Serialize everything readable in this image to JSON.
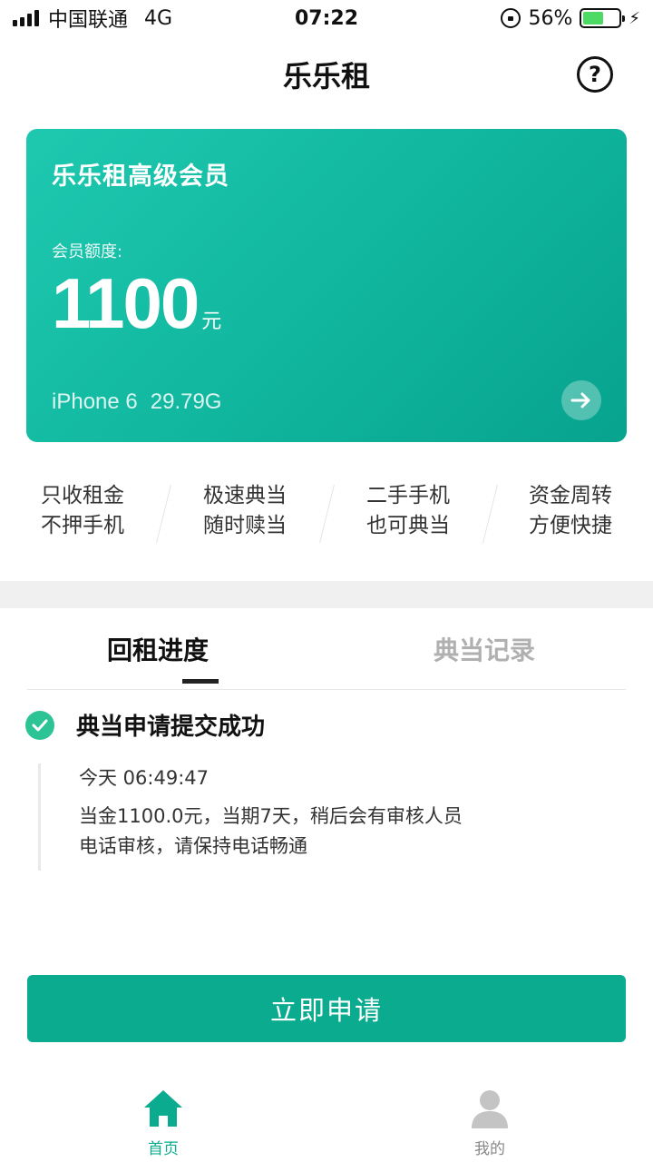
{
  "status_bar": {
    "carrier": "中国联通",
    "network": "4G",
    "time": "07:22",
    "battery_percent": "56%",
    "battery_level": 0.56
  },
  "nav": {
    "title": "乐乐租",
    "help_glyph": "?"
  },
  "card": {
    "title": "乐乐租高级会员",
    "quota_label": "会员额度:",
    "quota_value": "1100",
    "quota_unit": "元",
    "device_model": "iPhone 6",
    "device_storage": "29.79G"
  },
  "features": [
    {
      "line1": "只收租金",
      "line2": "不押手机"
    },
    {
      "line1": "极速典当",
      "line2": "随时赎当"
    },
    {
      "line1": "二手手机",
      "line2": "也可典当"
    },
    {
      "line1": "资金周转",
      "line2": "方便快捷"
    }
  ],
  "tabs": [
    {
      "label": "回租进度",
      "active": true
    },
    {
      "label": "典当记录",
      "active": false
    }
  ],
  "progress": {
    "title": "典当申请提交成功",
    "time": "今天 06:49:47",
    "description": "当金1100.0元，当期7天，稍后会有审核人员电话审核，请保持电话畅通"
  },
  "apply_button": "立即申请",
  "tab_bar": [
    {
      "label": "首页",
      "icon": "home-icon",
      "active": true
    },
    {
      "label": "我的",
      "icon": "user-icon",
      "active": false
    }
  ],
  "colors": {
    "brand": "#0aab8e",
    "check": "#2dc495",
    "battery": "#4cd964"
  }
}
